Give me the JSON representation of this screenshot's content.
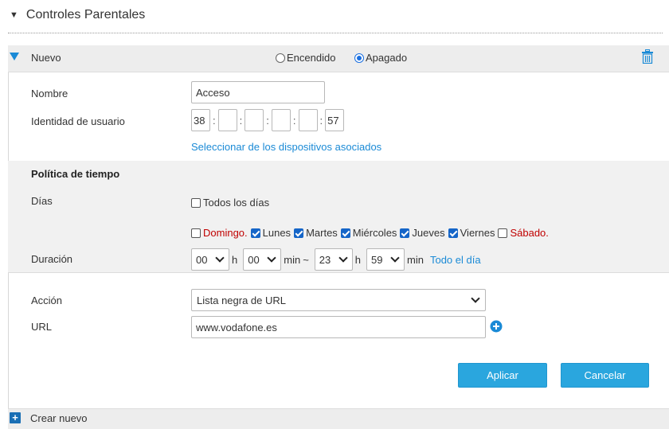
{
  "header": {
    "title": "Controles Parentales"
  },
  "rule": {
    "name": "Nuevo",
    "state": {
      "on_label": "Encendido",
      "off_label": "Apagado",
      "selected": "off"
    }
  },
  "form": {
    "name_label": "Nombre",
    "name_value": "Acceso",
    "userid_label": "Identidad de usuario",
    "mac": [
      "38",
      "",
      "",
      "",
      "",
      "57"
    ],
    "select_devices_link": "Seleccionar de los dispositivos asociados",
    "policy_title": "Política de tiempo",
    "days_label": "Días",
    "all_days_label": "Todos los días",
    "all_days_checked": false,
    "days": [
      {
        "label": "Domingo.",
        "checked": false,
        "weekend": true
      },
      {
        "label": "Lunes",
        "checked": true,
        "weekend": false
      },
      {
        "label": "Martes",
        "checked": true,
        "weekend": false
      },
      {
        "label": "Miércoles",
        "checked": true,
        "weekend": false
      },
      {
        "label": "Jueves",
        "checked": true,
        "weekend": false
      },
      {
        "label": "Viernes",
        "checked": true,
        "weekend": false
      },
      {
        "label": "Sábado.",
        "checked": false,
        "weekend": true
      }
    ],
    "duration_label": "Duración",
    "start_hour": "00",
    "start_min": "00",
    "end_hour": "23",
    "end_min": "59",
    "unit_h": "h",
    "unit_min": "min",
    "tilde": "~",
    "all_day_link": "Todo el día",
    "action_label": "Acción",
    "action_value": "Lista negra de URL",
    "url_label": "URL",
    "url_value": "www.vodafone.es"
  },
  "buttons": {
    "apply": "Aplicar",
    "cancel": "Cancelar"
  },
  "footer": {
    "create_new": "Crear nuevo"
  },
  "colors": {
    "accent": "#2aa6de",
    "link": "#1a8ad6",
    "weekend_red": "#c00000",
    "checkbox_blue": "#1565c8"
  },
  "icons": {
    "collapse": "triangle-down-icon",
    "delete": "trash-icon",
    "add_url": "plus-circle-icon",
    "add_new": "plus-square-icon"
  }
}
